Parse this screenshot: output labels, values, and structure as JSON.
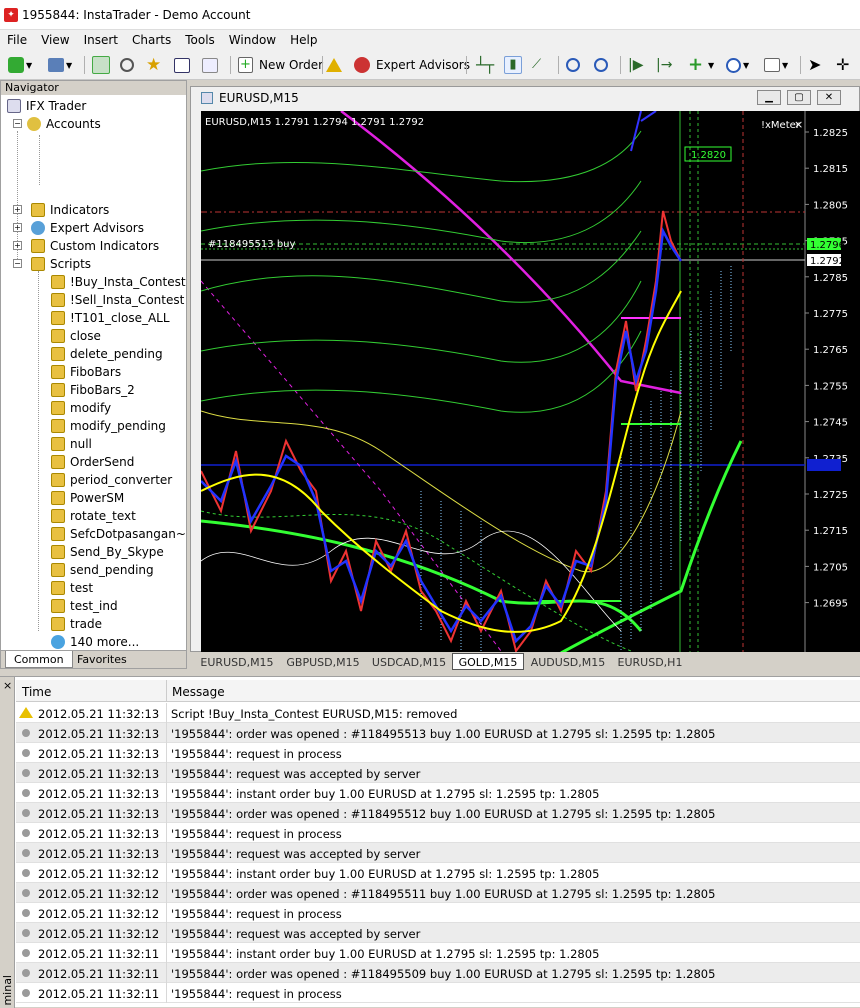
{
  "window": {
    "title": "1955844: InstaTrader - Demo Account"
  },
  "menu": [
    "File",
    "View",
    "Insert",
    "Charts",
    "Tools",
    "Window",
    "Help"
  ],
  "toolbar": {
    "new_order": "New Order",
    "expert_advisors": "Expert Advisors"
  },
  "navigator": {
    "title": "Navigator",
    "root": "IFX Trader",
    "accounts": "Accounts",
    "groups": [
      "Indicators",
      "Expert Advisors",
      "Custom Indicators",
      "Scripts"
    ],
    "scripts": [
      "!Buy_Insta_Contest",
      "!Sell_Insta_Contest",
      "!T101_close_ALL",
      "close",
      "delete_pending",
      "FiboBars",
      "FiboBars_2",
      "modify",
      "modify_pending",
      "null",
      "OrderSend",
      "period_converter",
      "PowerSM",
      "rotate_text",
      "SefcDotpasangan~",
      "Send_By_Skype",
      "send_pending",
      "test",
      "test_ind",
      "trade",
      "140 more..."
    ],
    "tabs": [
      "Common",
      "Favorites"
    ]
  },
  "chart": {
    "window_title": "EURUSD,M15",
    "info": "EURUSD,M15  1.2791 1.2794 1.2791 1.2792",
    "order_label": "#118495513 buy",
    "indicator_label": "!xMeter",
    "price_ticks": [
      "1.2825",
      "1.2815",
      "1.2805",
      "1.2795",
      "1.2785",
      "1.2775",
      "1.2765",
      "1.2755",
      "1.2745",
      "1.2735",
      "1.2725",
      "1.2715",
      "1.2705",
      "1.2695"
    ],
    "bid_badge": "1.2796",
    "current_price": "1.2792",
    "box_label": "1.2820",
    "tabs": [
      "EURUSD,M15",
      "GBPUSD,M15",
      "USDCAD,M15",
      "GOLD,M15",
      "AUDUSD,M15",
      "EURUSD,H1"
    ],
    "active_tab": "GOLD,M15"
  },
  "terminal": {
    "side_label": "minal",
    "columns": [
      "Time",
      "Message"
    ],
    "rows": [
      {
        "time": "2012.05.21 11:32:13",
        "msg": "Script !Buy_Insta_Contest EURUSD,M15: removed",
        "icon": "warning"
      },
      {
        "time": "2012.05.21 11:32:13",
        "msg": "'1955844': order was opened : #118495513 buy 1.00 EURUSD at 1.2795 sl: 1.2595 tp: 1.2805",
        "icon": "dot"
      },
      {
        "time": "2012.05.21 11:32:13",
        "msg": "'1955844': request in process",
        "icon": "dot"
      },
      {
        "time": "2012.05.21 11:32:13",
        "msg": "'1955844': request was accepted by server",
        "icon": "dot"
      },
      {
        "time": "2012.05.21 11:32:13",
        "msg": "'1955844': instant order buy 1.00 EURUSD at 1.2795 sl: 1.2595 tp: 1.2805",
        "icon": "dot"
      },
      {
        "time": "2012.05.21 11:32:13",
        "msg": "'1955844': order was opened : #118495512 buy 1.00 EURUSD at 1.2795 sl: 1.2595 tp: 1.2805",
        "icon": "dot"
      },
      {
        "time": "2012.05.21 11:32:13",
        "msg": "'1955844': request in process",
        "icon": "dot"
      },
      {
        "time": "2012.05.21 11:32:13",
        "msg": "'1955844': request was accepted by server",
        "icon": "dot"
      },
      {
        "time": "2012.05.21 11:32:12",
        "msg": "'1955844': instant order buy 1.00 EURUSD at 1.2795 sl: 1.2595 tp: 1.2805",
        "icon": "dot"
      },
      {
        "time": "2012.05.21 11:32:12",
        "msg": "'1955844': order was opened : #118495511 buy 1.00 EURUSD at 1.2795 sl: 1.2595 tp: 1.2805",
        "icon": "dot"
      },
      {
        "time": "2012.05.21 11:32:12",
        "msg": "'1955844': request in process",
        "icon": "dot"
      },
      {
        "time": "2012.05.21 11:32:12",
        "msg": "'1955844': request was accepted by server",
        "icon": "dot"
      },
      {
        "time": "2012.05.21 11:32:11",
        "msg": "'1955844': instant order buy 1.00 EURUSD at 1.2795 sl: 1.2595 tp: 1.2805",
        "icon": "dot"
      },
      {
        "time": "2012.05.21 11:32:11",
        "msg": "'1955844': order was opened : #118495509 buy 1.00 EURUSD at 1.2795 sl: 1.2595 tp: 1.2805",
        "icon": "dot"
      },
      {
        "time": "2012.05.21 11:32:11",
        "msg": "'1955844': request in process",
        "icon": "dot"
      }
    ]
  }
}
